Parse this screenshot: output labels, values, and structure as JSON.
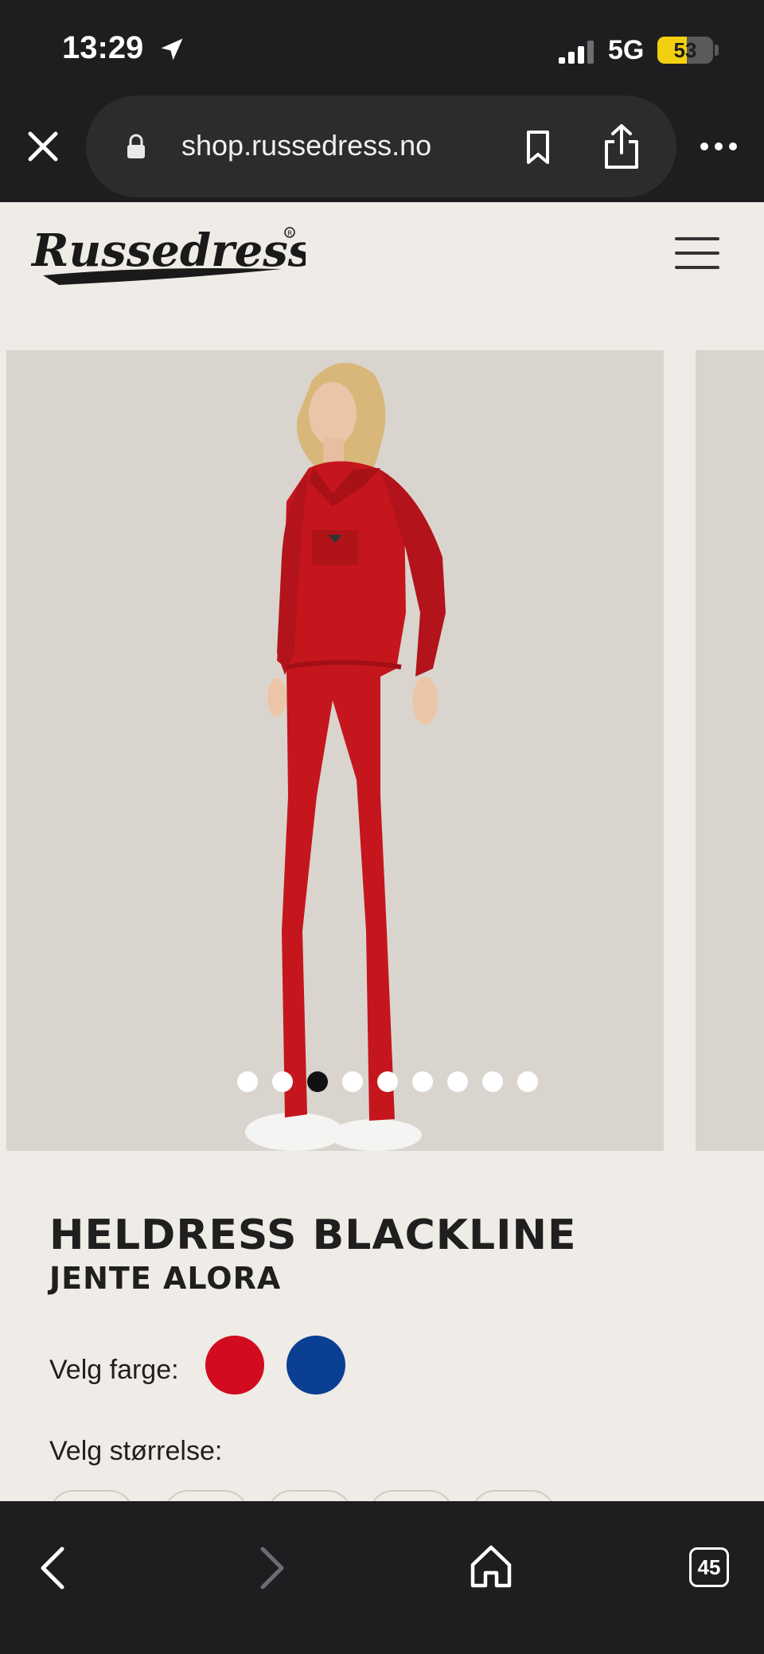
{
  "status_bar": {
    "time": "13:29",
    "network": "5G",
    "battery_level": "53",
    "battery_fraction": 0.53,
    "signal_bars_filled": 3,
    "signal_bars_total": 4
  },
  "browser": {
    "url": "shop.russedress.no",
    "close_icon": "close-icon",
    "lock_icon": "lock-icon",
    "bookmark_icon": "bookmark-icon",
    "share_icon": "share-icon",
    "more_icon": "more-icon"
  },
  "header": {
    "logo_text": "Russedress",
    "menu_icon": "hamburger-menu-icon"
  },
  "gallery": {
    "slide_count": 9,
    "active_index": 2
  },
  "product": {
    "title": "HELDRESS BLACKLINE",
    "subtitle": "JENTE ALORA",
    "color_label": "Velg farge:",
    "colors": [
      {
        "name": "red",
        "hex": "#d20c1e"
      },
      {
        "name": "blue",
        "hex": "#0b3f94"
      }
    ],
    "size_label": "Velg størrelse:"
  },
  "toolbar": {
    "back_icon": "chevron-left-icon",
    "forward_icon": "chevron-right-icon",
    "home_icon": "home-icon",
    "tab_count": "45"
  },
  "colors": {
    "chrome_bg": "#1e1e20",
    "page_bg": "#efebe6",
    "image_bg": "#d9d5ce",
    "battery": "#f2cf0f"
  }
}
